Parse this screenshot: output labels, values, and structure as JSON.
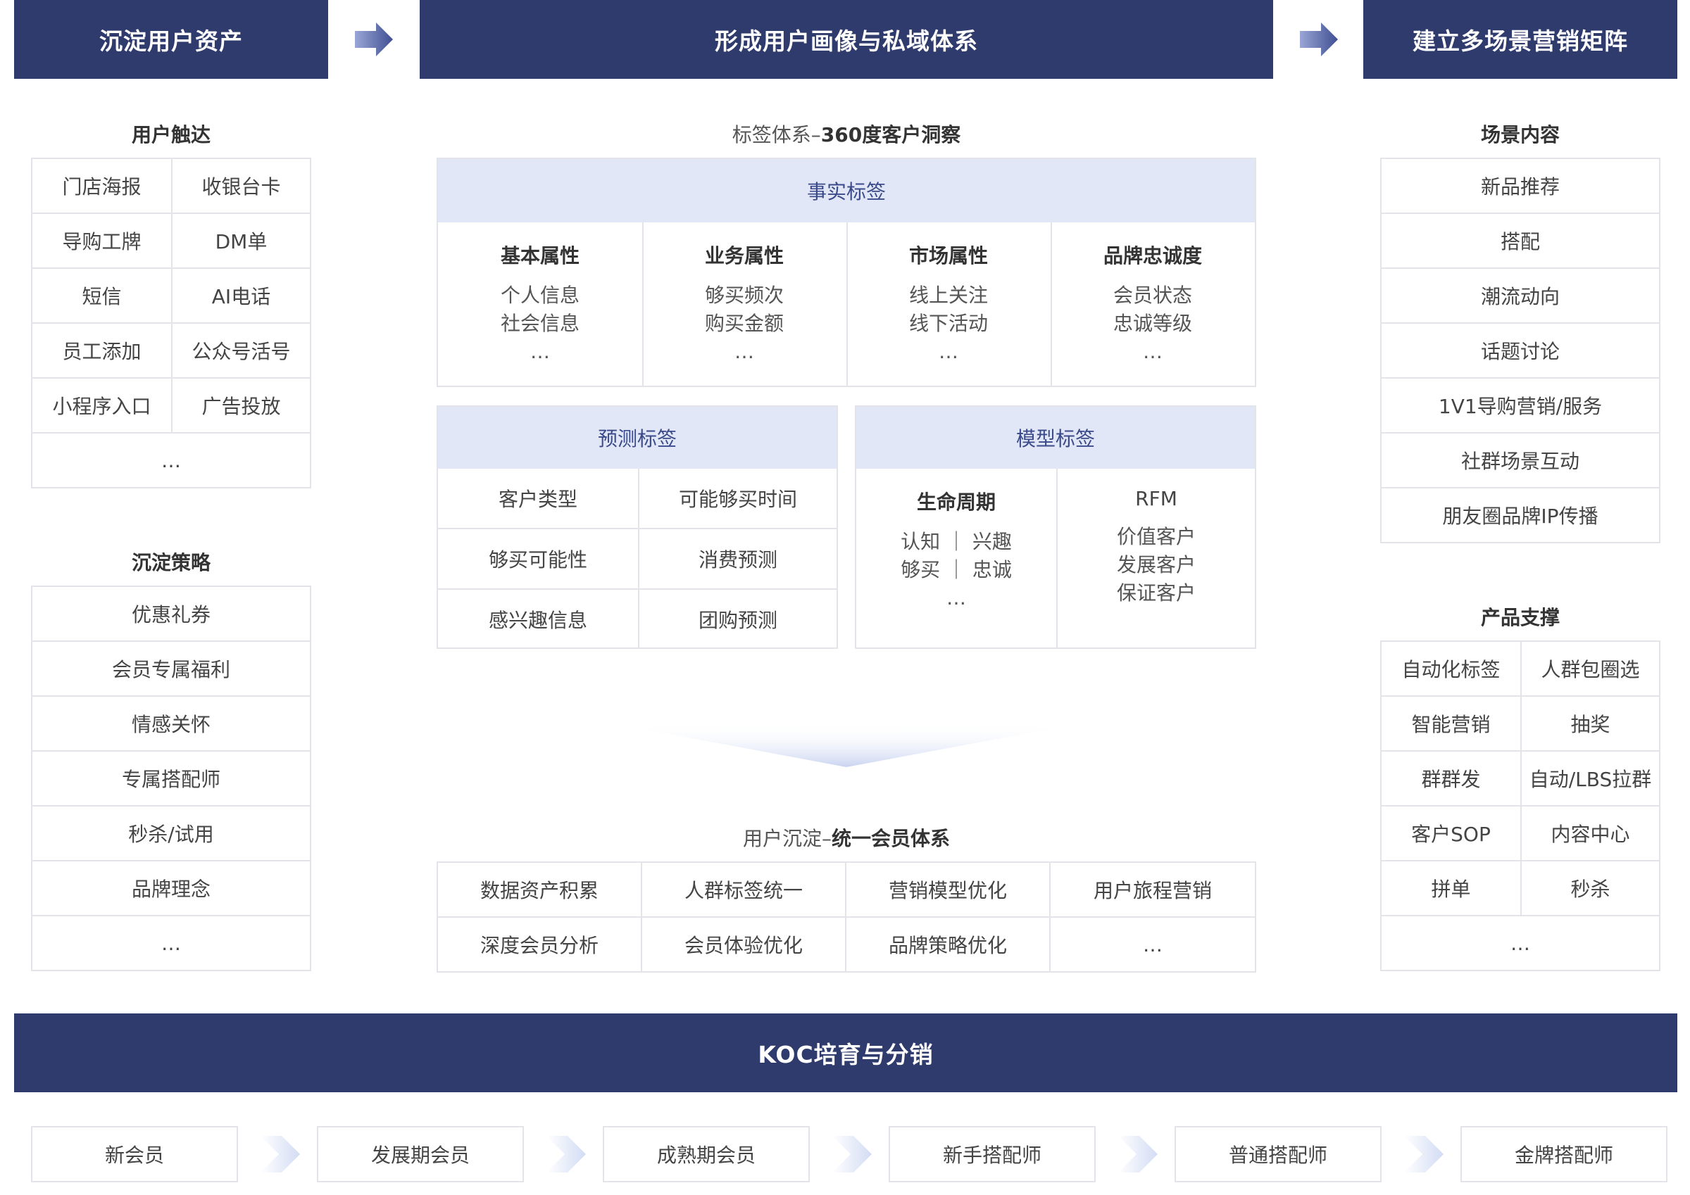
{
  "headers": {
    "left": "沉淀用户资产",
    "center": "形成用户画像与私域体系",
    "right": "建立多场景营销矩阵",
    "bottom": "KOC培育与分销"
  },
  "user_reach": {
    "title": "用户触达",
    "items": [
      [
        "门店海报",
        "收银台卡"
      ],
      [
        "导购工牌",
        "DM单"
      ],
      [
        "短信",
        "AI电话"
      ],
      [
        "员工添加",
        "公众号活号"
      ],
      [
        "小程序入口",
        "广告投放"
      ]
    ],
    "more": "…"
  },
  "strategy": {
    "title": "沉淀策略",
    "items": [
      "优惠礼券",
      "会员专属福利",
      "情感关怀",
      "专属搭配师",
      "秒杀/试用",
      "品牌理念",
      "…"
    ]
  },
  "tag_system": {
    "title_prefix": "标签体系–",
    "title_bold": "360度客户洞察",
    "fact": {
      "title": "事实标签",
      "cols": [
        {
          "title": "基本属性",
          "lines": [
            "个人信息",
            "社会信息",
            "…"
          ]
        },
        {
          "title": "业务属性",
          "lines": [
            "够买频次",
            "购买金额",
            "…"
          ]
        },
        {
          "title": "市场属性",
          "lines": [
            "线上关注",
            "线下活动",
            "…"
          ]
        },
        {
          "title": "品牌忠诚度",
          "lines": [
            "会员状态",
            "忠诚等级",
            "…"
          ]
        }
      ]
    },
    "predict": {
      "title": "预测标签",
      "rows": [
        [
          "客户类型",
          "可能够买时间"
        ],
        [
          "够买可能性",
          "消费预测"
        ],
        [
          "感兴趣信息",
          "团购预测"
        ]
      ]
    },
    "model": {
      "title": "模型标签",
      "cols": [
        {
          "title": "生命周期",
          "lines": [
            "认知 ｜ 兴趣",
            "够买 ｜ 忠诚",
            "…"
          ]
        },
        {
          "title": "RFM",
          "lines": [
            "价值客户",
            "发展客户",
            "保证客户"
          ]
        }
      ]
    }
  },
  "membership": {
    "title_prefix": "用户沉淀–",
    "title_bold": "统一会员体系",
    "rows": [
      [
        "数据资产积累",
        "人群标签统一",
        "营销模型优化",
        "用户旅程营销"
      ],
      [
        "深度会员分析",
        "会员体验优化",
        "品牌策略优化",
        "…"
      ]
    ]
  },
  "scenes": {
    "title": "场景内容",
    "items": [
      "新品推荐",
      "搭配",
      "潮流动向",
      "话题讨论",
      "1V1导购营销/服务",
      "社群场景互动",
      "朋友圈品牌IP传播"
    ]
  },
  "products": {
    "title": "产品支撑",
    "items": [
      [
        "自动化标签",
        "人群包圈选"
      ],
      [
        "智能营销",
        "抽奖"
      ],
      [
        "群群发",
        "自动/LBS拉群"
      ],
      [
        "客户SOP",
        "内容中心"
      ],
      [
        "拼单",
        "秒杀"
      ]
    ],
    "more": "…"
  },
  "koc_stages": [
    "新会员",
    "发展期会员",
    "成熟期会员",
    "新手搭配师",
    "普通搭配师",
    "金牌搭配师"
  ],
  "colors": {
    "header": "#2f3a6d",
    "panel_head": "#e1e7f6",
    "border": "#e2e4ea",
    "arrow": "#5a6aa8"
  }
}
